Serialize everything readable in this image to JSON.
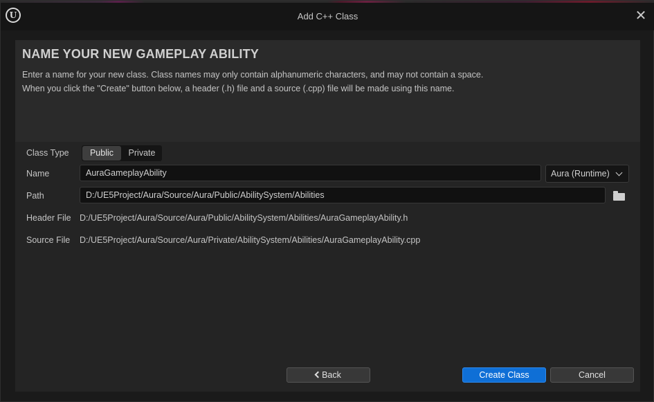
{
  "window": {
    "title": "Add C++ Class",
    "close_icon": "close-icon",
    "logo_icon": "unreal-engine-logo-icon",
    "logo_glyph": "U"
  },
  "header": {
    "heading": "NAME YOUR NEW GAMEPLAY ABILITY",
    "description_line1": "Enter a name for your new class. Class names may only contain alphanumeric characters, and may not contain a space.",
    "description_line2": "When you click the \"Create\" button below, a header (.h) file and a source (.cpp) file will be made using this name."
  },
  "form": {
    "class_type_label": "Class Type",
    "class_type_options": [
      "Public",
      "Private"
    ],
    "class_type_selected": "Public",
    "name_label": "Name",
    "name_value": "AuraGameplayAbility",
    "module_value": "Aura (Runtime)",
    "path_label": "Path",
    "path_value": "D:/UE5Project/Aura/Source/Aura/Public/AbilitySystem/Abilities",
    "folder_icon": "folder-icon",
    "header_file_label": "Header File",
    "header_file_value": "D:/UE5Project/Aura/Source/Aura/Public/AbilitySystem/Abilities/AuraGameplayAbility.h",
    "source_file_label": "Source File",
    "source_file_value": "D:/UE5Project/Aura/Source/Aura/Private/AbilitySystem/Abilities/AuraGameplayAbility.cpp"
  },
  "footer": {
    "back_label": "Back",
    "create_label": "Create Class",
    "cancel_label": "Cancel"
  },
  "colors": {
    "accent": "#0f6fd6",
    "background": "#1a1a1a",
    "panel": "#242424"
  }
}
